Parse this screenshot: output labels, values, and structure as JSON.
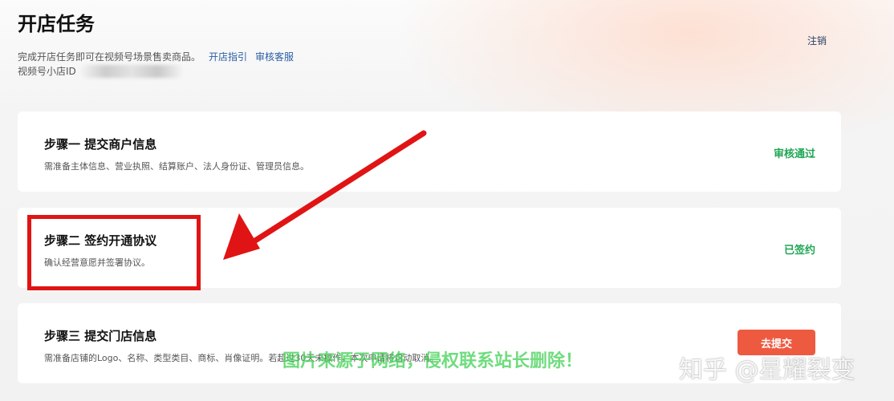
{
  "header": {
    "title": "开店任务",
    "subtitle": "完成开店任务即可在视频号场景售卖商品。",
    "guide_link": "开店指引",
    "support_link": "审核客服",
    "shop_id_label": "视频号小店ID",
    "logout": "注销"
  },
  "steps": [
    {
      "title": "步骤一 提交商户信息",
      "desc": "需准备主体信息、营业执照、结算账户、法人身份证、管理员信息。",
      "status": "审核通过"
    },
    {
      "title": "步骤二 签约开通协议",
      "desc": "确认经营意愿并签署协议。",
      "status": "已签约"
    },
    {
      "title": "步骤三 提交门店信息",
      "desc": "需准备店铺的Logo、名称、类型类目、商标、肖像证明。若超过30天未操作，本次申请将自动取消。",
      "button": "去提交"
    }
  ],
  "watermarks": {
    "green": "图片来源于网络，侵权联系站长删除！",
    "zhihu": "知乎 @星耀裂变"
  },
  "colors": {
    "success": "#1fa653",
    "primary_button": "#ee5a40",
    "annotation_red": "#e01414",
    "link": "#2b5ea5"
  }
}
